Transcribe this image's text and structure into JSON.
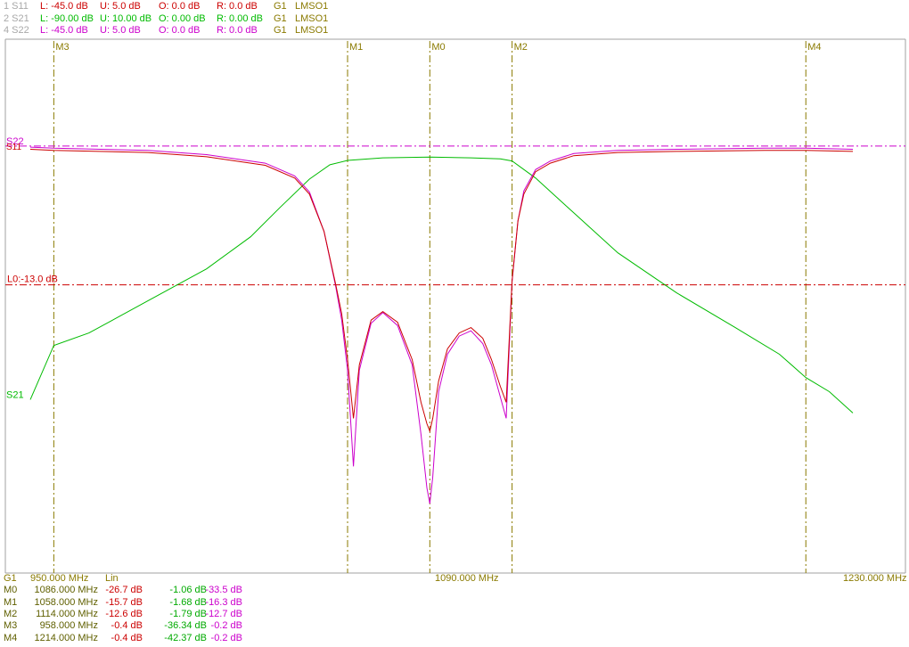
{
  "colors": {
    "s11": "#cc0000",
    "s21": "#00bb00",
    "s22": "#cc00cc",
    "marker": "#8a7a00",
    "limit": "#cc0000",
    "ref": "#cc00cc",
    "frame": "#a0a0a0"
  },
  "header": [
    {
      "id": "1 S11",
      "l": "L: -45.0 dB",
      "u": "U: 5.0 dB",
      "o": "O: 0.0 dB",
      "r": "R: 0.0 dB",
      "g": "G1",
      "lm": "LMSO1",
      "color": "#cc0000"
    },
    {
      "id": "2 S21",
      "l": "L: -90.00 dB",
      "u": "U: 10.00 dB",
      "o": "O: 0.00 dB",
      "r": "R: 0.00 dB",
      "g": "G1",
      "lm": "LMSO1",
      "color": "#00bb00"
    },
    {
      "id": "4 S22",
      "l": "L: -45.0 dB",
      "u": "U: 5.0 dB",
      "o": "O: 0.0 dB",
      "r": "R: 0.0 dB",
      "g": "G1",
      "lm": "LMSO1",
      "color": "#cc00cc"
    }
  ],
  "footer": {
    "group": "G1",
    "start": "950.000 MHz",
    "scale": "Lin",
    "center": "1090.000 MHz",
    "stop": "1230.000 MHz",
    "markers": [
      {
        "name": "M0",
        "freq": "1086.000 MHz",
        "s11": "-26.7 dB",
        "s21": "-1.06 dB",
        "s22": "-33.5 dB"
      },
      {
        "name": "M1",
        "freq": "1058.000 MHz",
        "s11": "-15.7 dB",
        "s21": "-1.68 dB",
        "s22": "-16.3 dB"
      },
      {
        "name": "M2",
        "freq": "1114.000 MHz",
        "s11": "-12.6 dB",
        "s21": "-1.79 dB",
        "s22": "-12.7 dB"
      },
      {
        "name": "M3",
        "freq": "958.000 MHz",
        "s11": "-0.4 dB",
        "s21": "-36.34 dB",
        "s22": "-0.2 dB"
      },
      {
        "name": "M4",
        "freq": "1214.000 MHz",
        "s11": "-0.4 dB",
        "s21": "-42.37 dB",
        "s22": "-0.2 dB"
      }
    ]
  },
  "chart_data": {
    "type": "line",
    "xlim": [
      950,
      1230
    ],
    "xunit": "MHz",
    "reflection_ylim": [
      -45,
      5
    ],
    "transmission_ylim": [
      -90,
      10
    ],
    "grid": false,
    "limit_line": {
      "label": "L0:-13.0 dB",
      "value": -13.0
    },
    "ref_line": {
      "value": 0.0
    },
    "trace_labels": {
      "s11": "S11",
      "s21": "S21",
      "s22": "S22"
    },
    "markers": [
      {
        "name": "M3",
        "freq": 958
      },
      {
        "name": "M1",
        "freq": 1058
      },
      {
        "name": "M0",
        "freq": 1086
      },
      {
        "name": "M2",
        "freq": 1114
      },
      {
        "name": "M4",
        "freq": 1214
      }
    ],
    "series": [
      {
        "name": "S11",
        "axis": "reflection",
        "x": [
          950,
          958,
          990,
          1010,
          1030,
          1040,
          1045,
          1050,
          1054,
          1056,
          1058,
          1060,
          1062,
          1066,
          1070,
          1075,
          1080,
          1083,
          1085,
          1086,
          1087,
          1089,
          1092,
          1096,
          1100,
          1104,
          1107,
          1110,
          1112,
          1114,
          1116,
          1118,
          1122,
          1127,
          1135,
          1150,
          1170,
          1200,
          1214,
          1230
        ],
        "y": [
          -0.3,
          -0.4,
          -0.6,
          -1.0,
          -1.8,
          -3.0,
          -4.5,
          -8.0,
          -13.0,
          -15.7,
          -20.0,
          -25.5,
          -20.5,
          -16.3,
          -15.5,
          -16.5,
          -20.0,
          -24.0,
          -26.0,
          -26.7,
          -25.5,
          -22.0,
          -19.0,
          -17.5,
          -17.0,
          -18.0,
          -20.0,
          -22.5,
          -24.0,
          -12.6,
          -7.0,
          -4.5,
          -2.4,
          -1.6,
          -0.9,
          -0.6,
          -0.5,
          -0.4,
          -0.4,
          -0.5
        ]
      },
      {
        "name": "S21",
        "axis": "transmission",
        "x": [
          950,
          958,
          970,
          990,
          1010,
          1025,
          1035,
          1045,
          1052,
          1058,
          1070,
          1086,
          1100,
          1110,
          1114,
          1122,
          1135,
          1150,
          1170,
          1190,
          1205,
          1214,
          1222,
          1230
        ],
        "y": [
          -46.5,
          -36.34,
          -34.0,
          -28.0,
          -22.0,
          -16.0,
          -10.5,
          -5.2,
          -2.5,
          -1.68,
          -1.2,
          -1.06,
          -1.2,
          -1.4,
          -1.79,
          -5.0,
          -11.5,
          -19.0,
          -26.5,
          -33.0,
          -38.0,
          -42.37,
          -45.0,
          -49.0
        ]
      },
      {
        "name": "S22",
        "axis": "reflection",
        "x": [
          950,
          958,
          990,
          1010,
          1030,
          1040,
          1045,
          1050,
          1054,
          1056,
          1058,
          1060,
          1062,
          1066,
          1070,
          1075,
          1080,
          1083,
          1085,
          1086,
          1087,
          1089,
          1092,
          1096,
          1100,
          1104,
          1107,
          1110,
          1112,
          1114,
          1116,
          1118,
          1122,
          1127,
          1135,
          1150,
          1170,
          1200,
          1214,
          1230
        ],
        "y": [
          -0.1,
          -0.2,
          -0.4,
          -0.8,
          -1.6,
          -2.8,
          -4.3,
          -8.0,
          -13.2,
          -16.3,
          -21.0,
          -30.0,
          -21.0,
          -16.6,
          -15.6,
          -16.8,
          -20.5,
          -27.0,
          -32.0,
          -33.5,
          -31.0,
          -23.0,
          -19.5,
          -17.8,
          -17.3,
          -18.5,
          -20.5,
          -23.5,
          -25.5,
          -12.7,
          -7.0,
          -4.2,
          -2.2,
          -1.4,
          -0.7,
          -0.4,
          -0.3,
          -0.2,
          -0.2,
          -0.3
        ]
      }
    ]
  }
}
